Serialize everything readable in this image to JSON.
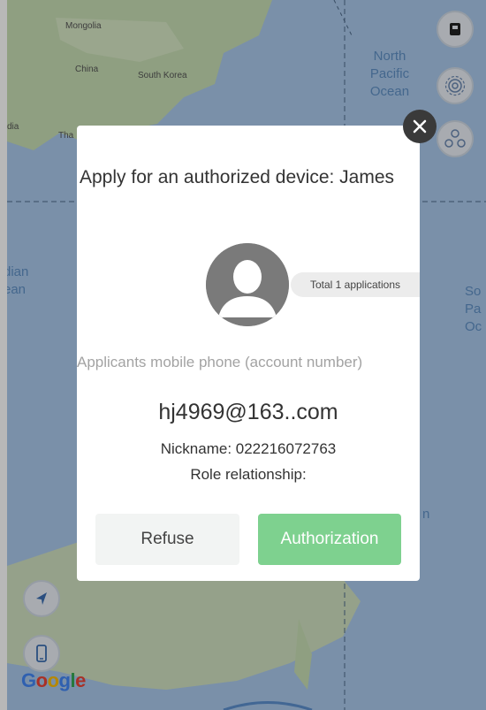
{
  "map": {
    "labels": {
      "mongolia": "Mongolia",
      "china": "China",
      "south_korea": "South Korea",
      "dia": "dia",
      "tha": "Tha",
      "north_pacific_ocean": [
        "North",
        "Pacific",
        "Ocean"
      ],
      "indian_ocean": [
        "dian",
        "ean"
      ],
      "south_pacific_ocean": [
        "So",
        "Pa",
        "Oc"
      ],
      "n_fragment": "n"
    },
    "provider": {
      "letters": [
        "G",
        "o",
        "o",
        "g",
        "l",
        "e"
      ],
      "colors": [
        "#4285f4",
        "#ea4335",
        "#fbbc05",
        "#4285f4",
        "#34a853",
        "#ea4335"
      ]
    }
  },
  "dialog": {
    "title": "Apply for an authorized device: James",
    "applications_count": "Total 1 applications",
    "phone_label": "Applicants mobile phone (account number)",
    "account": "hj4969@163..com",
    "nickname": "Nickname: 022216072763",
    "role": "Role relationship:",
    "refuse_label": "Refuse",
    "authorize_label": "Authorization"
  },
  "colors": {
    "authorize_bg": "#7ed18f",
    "ocean": "#a9c8ea",
    "land": "#c7ddb6"
  }
}
